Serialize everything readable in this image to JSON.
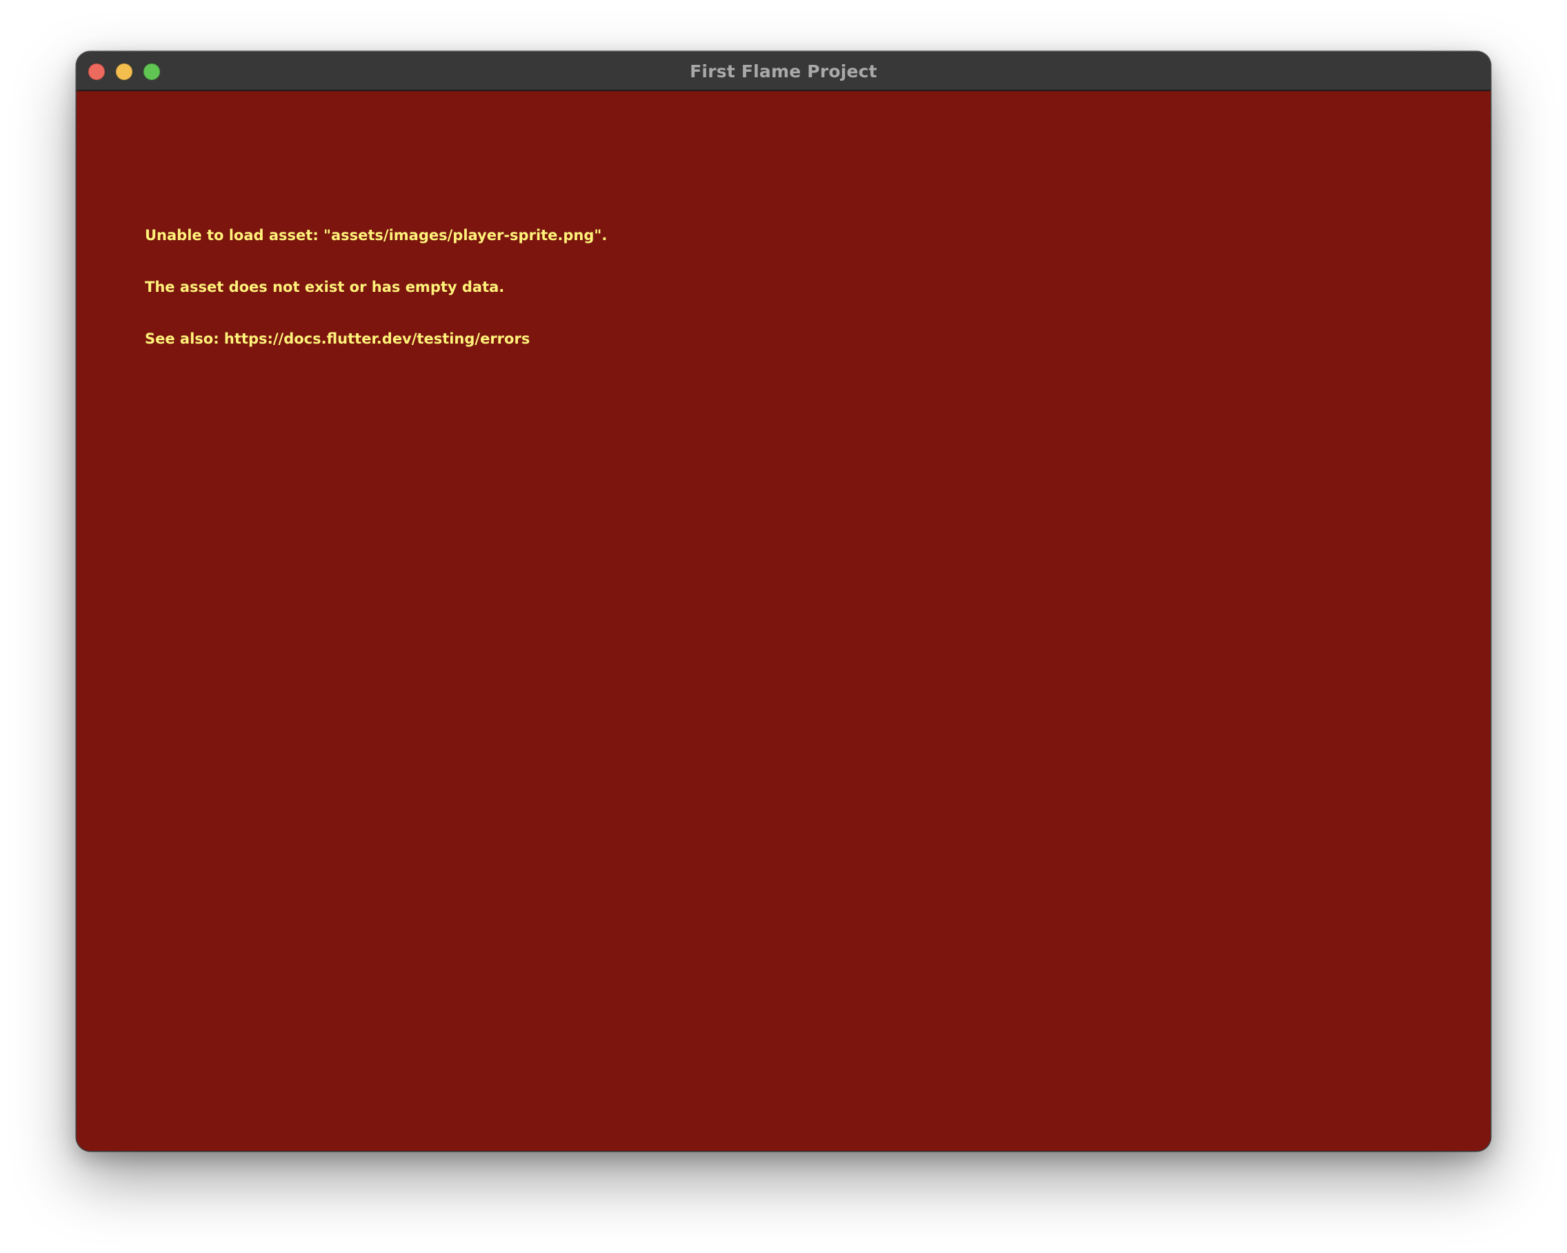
{
  "window": {
    "title": "First Flame Project",
    "background_color": "#7b150e"
  },
  "titlebar": {
    "buttons": [
      {
        "name": "close",
        "color": "#ed6a5e"
      },
      {
        "name": "minimize",
        "color": "#f5bf4f"
      },
      {
        "name": "maximize",
        "color": "#61c554"
      }
    ]
  },
  "error": {
    "text_color": "#fff27a",
    "lines": [
      "Unable to load asset: \"assets/images/player-sprite.png\".",
      "The asset does not exist or has empty data.",
      "See also: https://docs.flutter.dev/testing/errors"
    ]
  }
}
